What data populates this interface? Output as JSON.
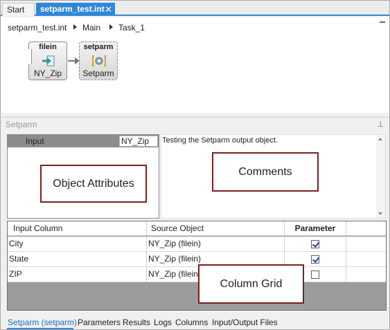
{
  "tabs": {
    "start": "Start",
    "active": "setparm_test.int",
    "close_glyph": "✕"
  },
  "breadcrumb": [
    "setparm_test.int",
    "Main",
    "Task_1"
  ],
  "canvas": {
    "nodes": [
      {
        "title": "filein",
        "label": "NY_Zip",
        "icon": "file-input-arrow-icon"
      },
      {
        "title": "setparm",
        "label": "Setparm",
        "icon": "setparm-gear-icon"
      }
    ]
  },
  "panel": {
    "title": "Setparm",
    "pin_glyph": "⊥"
  },
  "attributes": {
    "header_label": "Input",
    "input_value": "NY_Zip"
  },
  "comments": {
    "text": "Testing the Setparm output object."
  },
  "callouts": {
    "object_attributes": "Object Attributes",
    "comments": "Comments",
    "column_grid": "Column Grid"
  },
  "grid": {
    "columns": [
      "Input Column",
      "Source Object",
      "Parameter",
      ""
    ],
    "rows": [
      {
        "input_column": "City",
        "source_object": "NY_Zip (filein)",
        "parameter": true
      },
      {
        "input_column": "State",
        "source_object": "NY_Zip (filein)",
        "parameter": true
      },
      {
        "input_column": "ZIP",
        "source_object": "NY_Zip (filein)",
        "parameter": false
      }
    ]
  },
  "bottom_tabs": [
    "Setparm (setparm)",
    "Parameters",
    "Results",
    "Logs",
    "Columns",
    "Input/Output Files"
  ],
  "colors": {
    "accent": "#2f87d8",
    "callout_border": "#7b1f1f",
    "grid_background": "#9c9c9c"
  }
}
